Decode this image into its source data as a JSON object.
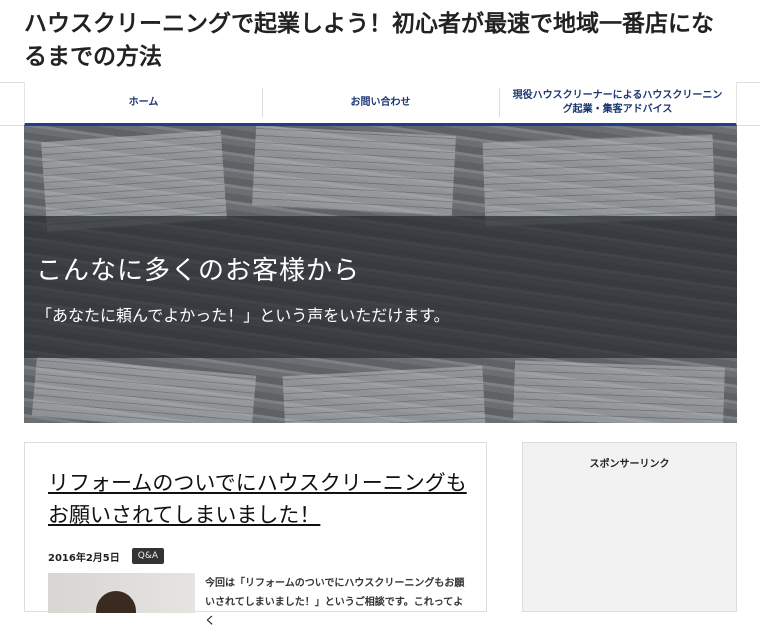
{
  "site": {
    "title": "ハウスクリーニングで起業しよう！初心者が最速で地域一番店になるまでの方法"
  },
  "nav": {
    "items": [
      {
        "label": "ホーム"
      },
      {
        "label": "お問い合わせ"
      },
      {
        "label": "現役ハウスクリーナーによるハウスクリーニング起業・集客アドバイス"
      }
    ]
  },
  "hero": {
    "heading": "こんなに多くのお客様から",
    "subheading": "「あなたに頼んでよかった！」という声をいただけます。"
  },
  "post": {
    "title": "リフォームのついでにハウスクリーニングもお願いされてしまいました！",
    "date": "2016年2月5日",
    "category": "Q&A",
    "excerpt": "今回は「リフォームのついでにハウスクリーニングもお願いされてしまいました！」というご相談です。これってよく"
  },
  "sidebar": {
    "heading": "スポンサーリンク"
  },
  "colors": {
    "nav_accent": "#1e3f8c",
    "nav_text": "#1b3670"
  }
}
